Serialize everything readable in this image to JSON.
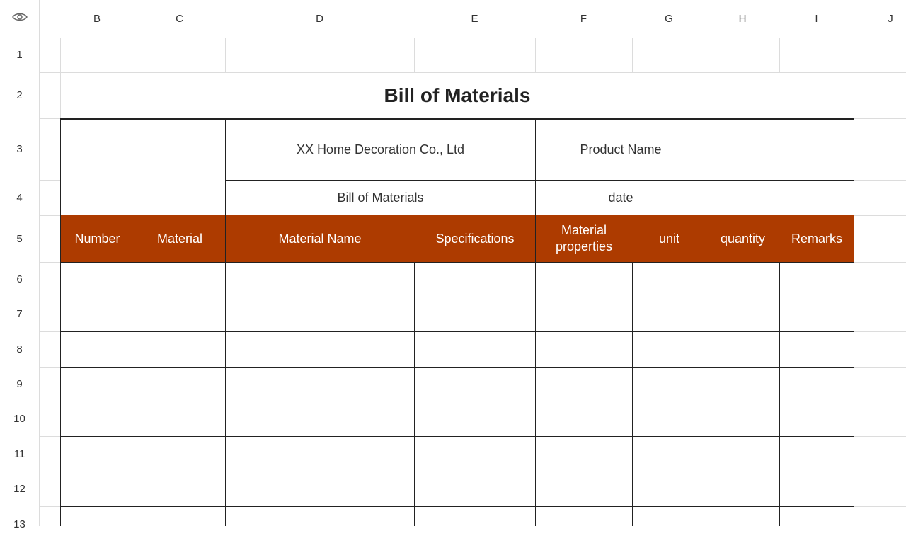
{
  "corner": {
    "icon": "eye-icon"
  },
  "columns": [
    "B",
    "C",
    "D",
    "E",
    "F",
    "G",
    "H",
    "I",
    "J"
  ],
  "rows": [
    "1",
    "2",
    "3",
    "4",
    "5",
    "6",
    "7",
    "8",
    "9",
    "10",
    "11",
    "12",
    "13"
  ],
  "sheet": {
    "title": "Bill of Materials",
    "company": "XX Home Decoration Co., Ltd",
    "subtitle": "Bill of Materials",
    "product_name_label": "Product Name",
    "date_label": "date",
    "table_headers": {
      "number": "Number",
      "material": "Material",
      "material_name": "Material Name",
      "specifications": "Specifications",
      "material_properties_line1": "Material",
      "material_properties_line2": "properties",
      "unit": "unit",
      "quantity": "quantity",
      "remarks": "Remarks"
    }
  },
  "colors": {
    "header_fill": "#ad3b00",
    "gridline": "#dcdcdc",
    "border": "#222222"
  }
}
